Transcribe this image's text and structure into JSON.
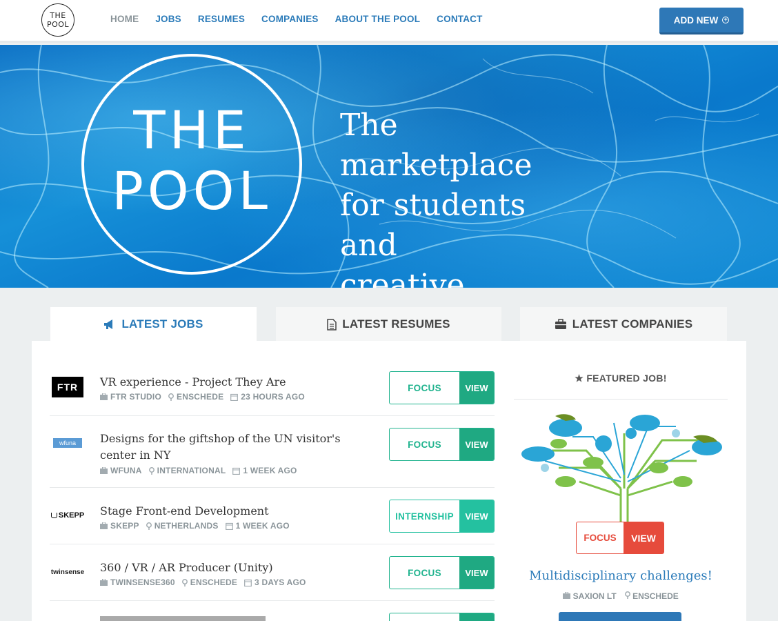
{
  "header": {
    "logo_line1": "THE",
    "logo_line2": "POOL",
    "nav": [
      "HOME",
      "JOBS",
      "RESUMES",
      "COMPANIES",
      "ABOUT THE POOL",
      "CONTACT"
    ],
    "add_button": "ADD NEW"
  },
  "hero": {
    "logo_line1": "THE",
    "logo_line2": "POOL",
    "tagline": [
      "The marketplace",
      "for students and",
      "creative projects"
    ]
  },
  "tabs": [
    "LATEST JOBS",
    "LATEST RESUMES",
    "LATEST COMPANIES"
  ],
  "jobs": [
    {
      "logo": "FTR",
      "title": "VR experience - Project They Are",
      "company": "FTR STUDIO",
      "location": "ENSCHEDE",
      "time": "23 HOURS AGO",
      "type": "FOCUS",
      "view": "VIEW"
    },
    {
      "logo": "wfuna",
      "title": "Designs for the giftshop of the UN visitor's center in NY",
      "company": "WFUNA",
      "location": "INTERNATIONAL",
      "time": "1 WEEK AGO",
      "type": "FOCUS",
      "view": "VIEW"
    },
    {
      "logo": "SKEPP",
      "title": "Stage Front-end Development",
      "company": "SKEPP",
      "location": "NETHERLANDS",
      "time": "1 WEEK AGO",
      "type": "INTERNSHIP",
      "view": "VIEW"
    },
    {
      "logo": "twinsense",
      "title": "360 / VR / AR Producer (Unity)",
      "company": "TWINSENSE360",
      "location": "ENSCHEDE",
      "time": "3 DAYS AGO",
      "type": "FOCUS",
      "view": "VIEW"
    }
  ],
  "featured": {
    "heading": "FEATURED JOB!",
    "type": "FOCUS",
    "view": "VIEW",
    "title": "Multidisciplinary challenges!",
    "company": "SAXION LT",
    "location": "ENSCHEDE"
  },
  "colors": {
    "brand_blue": "#2b7bb9",
    "focus_green": "#1fa982",
    "internship_green": "#24c1a0",
    "featured_red": "#e64b3c"
  }
}
